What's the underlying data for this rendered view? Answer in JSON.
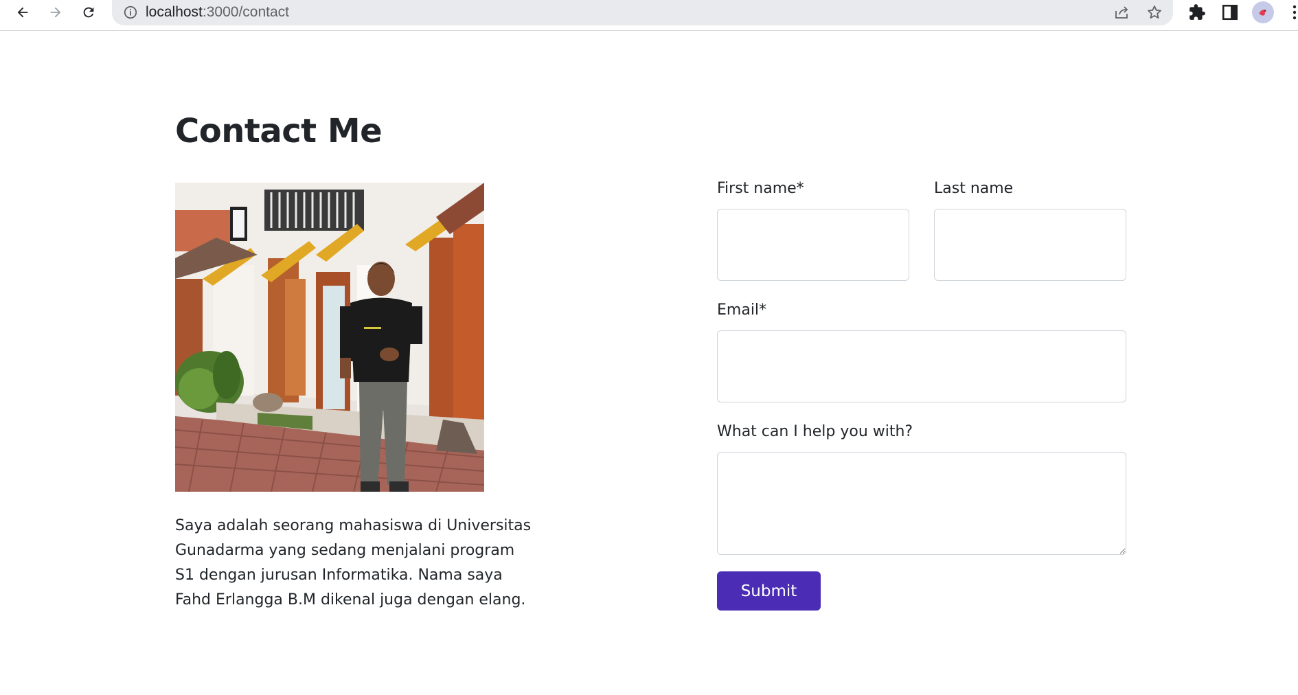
{
  "browser": {
    "url_host": "localhost",
    "url_path": ":3000/contact",
    "icons": [
      "back-icon",
      "forward-icon",
      "reload-icon",
      "info-icon",
      "share-icon",
      "star-icon",
      "extensions-icon",
      "side-panel-icon",
      "profile-avatar",
      "menu-icon"
    ]
  },
  "page": {
    "title": "Contact Me",
    "bio": "Saya adalah seorang mahasiswa di Universitas Gunadarma yang sedang menjalani program S1 dengan jurusan Informatika. Nama saya Fahd Erlangga B.M dikenal juga dengan elang."
  },
  "form": {
    "first_name_label": "First name*",
    "first_name_value": "",
    "last_name_label": "Last name",
    "last_name_value": "",
    "email_label": "Email*",
    "email_value": "",
    "message_label": "What can I help you with?",
    "message_value": "",
    "submit_label": "Submit"
  },
  "colors": {
    "submit_bg": "#4a2db4",
    "text": "#212529",
    "field_border": "#cfd4da"
  }
}
